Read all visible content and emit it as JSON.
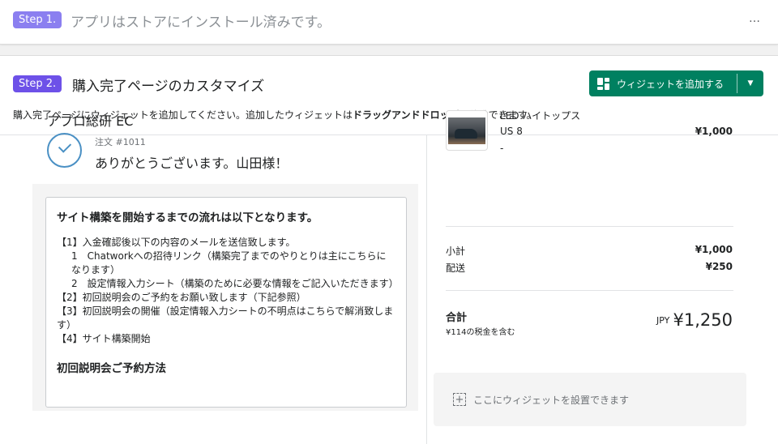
{
  "step1": {
    "badge": "Step 1.",
    "text": "アプリはストアにインストール済みです。",
    "more_icon": "…"
  },
  "step2": {
    "badge": "Step 2.",
    "title": "購入完了ページのカスタマイズ",
    "desc_pre": "購入完了ページにウィジェットを追加してください。追加したウィジェットは",
    "desc_bold": "ドラッグアンドドロップ",
    "desc_post": "で移動できます。",
    "add_button": "ウィジェットを追加する",
    "dropdown_icon": "▼"
  },
  "order": {
    "shop_name": "アプロ総研 EC",
    "order_number": "注文 #1011",
    "thanks": "ありがとうございます。山田様！"
  },
  "info": {
    "title": "サイト構築を開始するまでの流れは以下となります。",
    "lines": [
      "【1】入金確認後以下の内容のメールを送信致します。",
      "1　Chatworkへの招待リンク（構築完了までのやりとりは主にこちらになります）",
      "2　設定情報入力シート（構築のために必要な情報をご記入いただきます）",
      "【2】初回説明会のご予約をお願い致します（下記参照）",
      "【3】初回説明会の開催（設定情報入力シートの不明点はこちらで解消致します）",
      "【4】サイト構築開始"
    ],
    "subtitle": "初回説明会ご予約方法"
  },
  "summary": {
    "product_name": "LED ハイトップス",
    "variant": "US 8",
    "dash": "-",
    "price": "¥1,000",
    "subtotal_label": "小計",
    "subtotal": "¥1,000",
    "shipping_label": "配送",
    "shipping": "¥250",
    "total_label": "合計",
    "tax_note": "¥114の税金を含む",
    "currency": "JPY",
    "total": "¥1,250",
    "widget_placeholder": "ここにウィジェットを設置できます",
    "placeholder_icon": "+"
  }
}
